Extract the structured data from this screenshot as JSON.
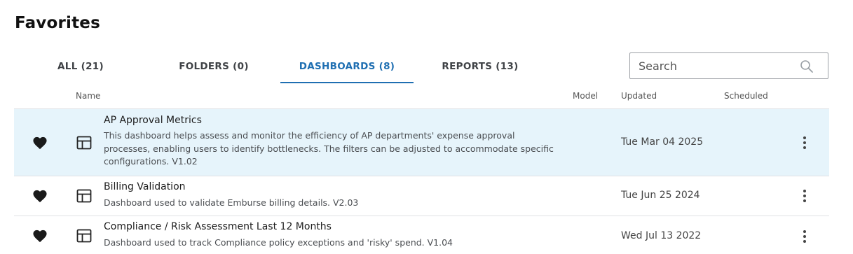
{
  "page": {
    "title": "Favorites"
  },
  "tabs": [
    {
      "label": "ALL (21)",
      "active": false
    },
    {
      "label": "FOLDERS (0)",
      "active": false
    },
    {
      "label": "DASHBOARDS (8)",
      "active": true
    },
    {
      "label": "REPORTS (13)",
      "active": false
    }
  ],
  "search": {
    "placeholder": "Search",
    "icon": "search-icon"
  },
  "columns": {
    "name": "Name",
    "model": "Model",
    "updated": "Updated",
    "scheduled": "Scheduled"
  },
  "colors": {
    "accent": "#1f6fb2",
    "selected_row_bg": "#e6f4fb"
  },
  "rows": [
    {
      "title": "AP Approval Metrics",
      "description": "This dashboard helps assess and monitor the efficiency of AP departments' expense approval processes, enabling users to identify bottlenecks. The filters can be adjusted to accommodate specific configurations. V1.02",
      "updated": "Tue Mar 04 2025",
      "favorite": true,
      "selected": true
    },
    {
      "title": "Billing Validation",
      "description": "Dashboard used to validate Emburse billing details. V2.03",
      "updated": "Tue Jun 25 2024",
      "favorite": true,
      "selected": false
    },
    {
      "title": "Compliance / Risk Assessment Last 12 Months",
      "description": "Dashboard used to track Compliance policy exceptions and 'risky' spend. V1.04",
      "updated": "Wed Jul 13 2022",
      "favorite": true,
      "selected": false
    }
  ]
}
